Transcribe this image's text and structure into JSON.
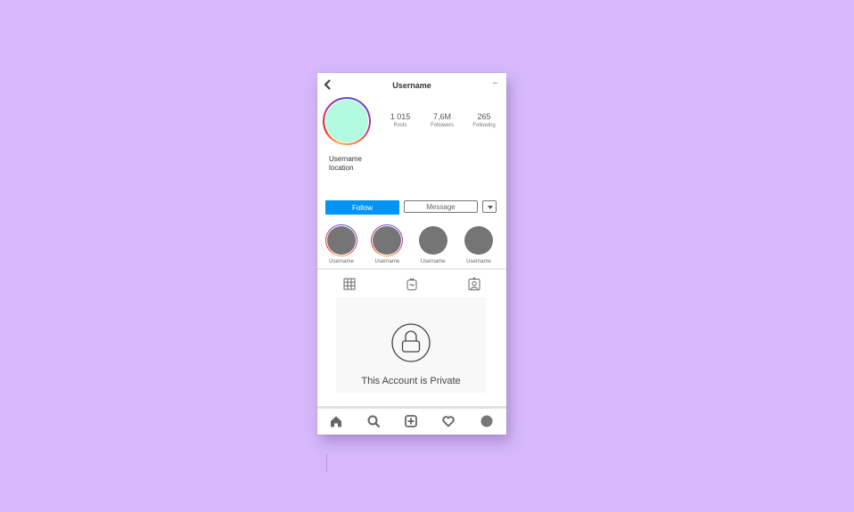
{
  "colors": {
    "background": "#d6b8fb",
    "accent": "#0095f6",
    "avatar_fill": "#b3fbe0",
    "highlight_fill": "#757575",
    "icon": "#666666"
  },
  "header": {
    "back_icon": "chevron-left-icon",
    "title": "Username",
    "more_icon": "more-horizontal-icon",
    "more_glyph": "•••"
  },
  "profile": {
    "stats": [
      {
        "value": "1 015",
        "label": "Posts"
      },
      {
        "value": "7,6M",
        "label": "Followers"
      },
      {
        "value": "265",
        "label": "Following"
      }
    ],
    "bio": {
      "name": "Username",
      "location": "location"
    }
  },
  "actions": {
    "follow_label": "Follow",
    "message_label": "Message",
    "more_icon": "caret-down-icon"
  },
  "highlights": [
    {
      "name": "Username",
      "has_story_ring": true
    },
    {
      "name": "Username",
      "has_story_ring": true
    },
    {
      "name": "Username",
      "has_story_ring": false
    },
    {
      "name": "Username",
      "has_story_ring": false
    }
  ],
  "tabs": [
    {
      "icon": "grid-icon"
    },
    {
      "icon": "igtv-icon"
    },
    {
      "icon": "tagged-icon"
    }
  ],
  "private_notice": {
    "icon": "lock-icon",
    "text": "This Account is Private"
  },
  "bottom_nav": [
    {
      "icon": "home-icon"
    },
    {
      "icon": "search-icon"
    },
    {
      "icon": "add-post-icon"
    },
    {
      "icon": "heart-icon"
    },
    {
      "icon": "profile-icon"
    }
  ]
}
